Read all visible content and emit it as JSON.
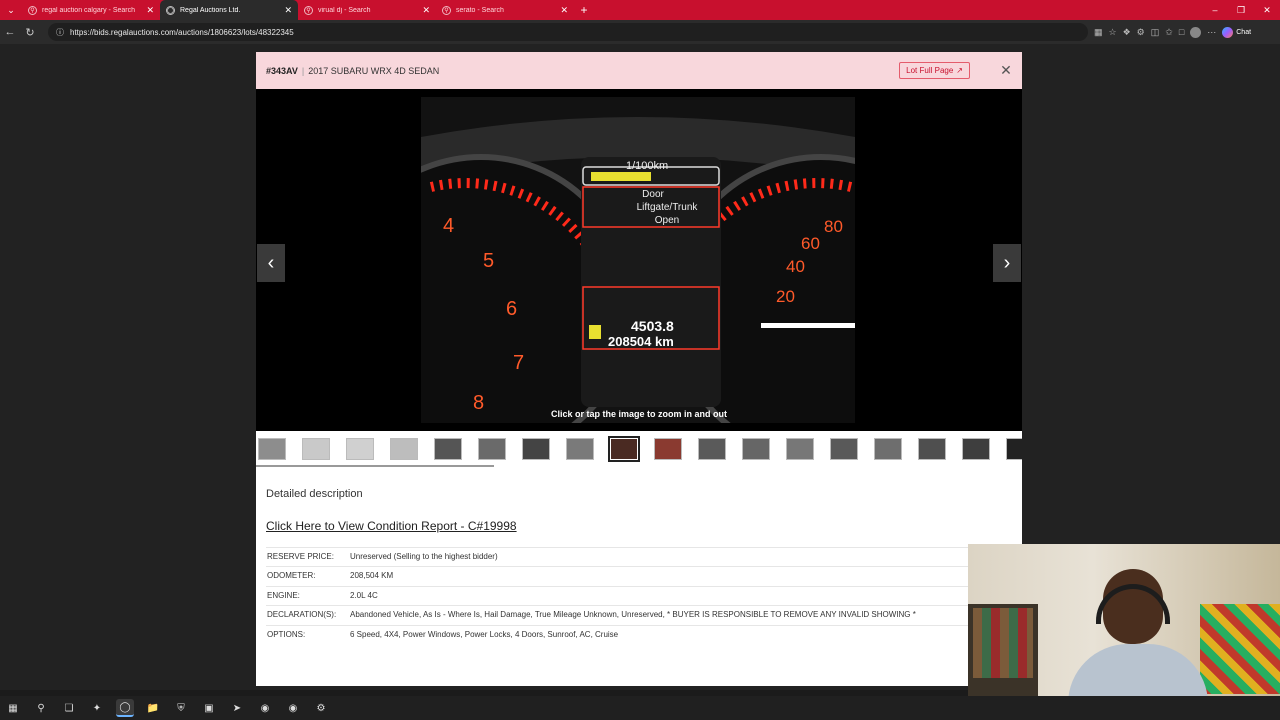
{
  "browser": {
    "tabs": [
      {
        "title": "regal auction calgary - Search",
        "active": false
      },
      {
        "title": "Regal Auctions Ltd.",
        "active": true
      },
      {
        "title": "virual dj - Search",
        "active": false
      },
      {
        "title": "serato - Search",
        "active": false
      }
    ],
    "url": "https://bids.regalauctions.com/auctions/1806623/lots/48322345",
    "chat_label": "Chat"
  },
  "lot": {
    "number": "#343AV",
    "title": "2017 SUBARU WRX 4D SEDAN",
    "full_page_label": "Lot Full Page",
    "zoom_hint": "Click or tap the image to zoom in and out",
    "thumbnail_count": 18,
    "selected_thumbnail": 9,
    "photo_readouts": {
      "consumption_label": "1/100km",
      "message": [
        "Door",
        "Liftgate/Trunk",
        "Open"
      ],
      "trip": "4503.8",
      "odometer": "208504 km"
    }
  },
  "description": {
    "heading": "Detailed description",
    "condition_link": "Click Here to View Condition Report - C#19998",
    "specs": [
      {
        "label": "RESERVE PRICE:",
        "value": "Unreserved (Selling to the highest bidder)"
      },
      {
        "label": "ODOMETER:",
        "value": "208,504 KM"
      },
      {
        "label": "ENGINE:",
        "value": "2.0L 4C"
      },
      {
        "label": "DECLARATION(S):",
        "value": "Abandoned Vehicle, As Is - Where Is, Hail Damage, True Mileage Unknown, Unreserved, * BUYER IS RESPONSIBLE TO REMOVE ANY INVALID SHOWING *"
      },
      {
        "label": "OPTIONS:",
        "value": "6 Speed, 4X4, Power Windows, Power Locks, 4 Doors, Sunroof, AC, Cruise"
      }
    ]
  },
  "colors": {
    "tabstrip": "#c8102e",
    "modal_header": "#f8d7dc",
    "accent": "#c8102e"
  }
}
